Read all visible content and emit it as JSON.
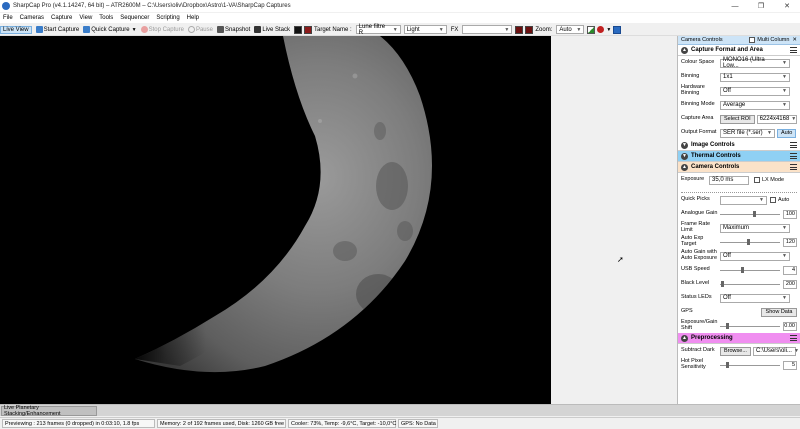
{
  "window": {
    "title": "SharpCap Pro (v4.1.14247, 64 bit) – ATR2600M – C:\\Users\\oliv\\Dropbox\\Astro\\1-VA\\SharpCap Captures",
    "minimize": "—",
    "maximize": "❐",
    "close": "✕"
  },
  "menu": [
    "File",
    "Cameras",
    "Capture",
    "View",
    "Tools",
    "Sequencer",
    "Scripting",
    "Help"
  ],
  "toolbar": {
    "live_view": "Live View",
    "start_capture": "Start Capture",
    "quick_capture": "Quick Capture",
    "stop_capture": "Stop Capture",
    "pause": "Pause",
    "snapshot": "Snapshot",
    "live_stack": "Live Stack",
    "target_name_label": "Target Name :",
    "target_name_value": "Lune filtre R",
    "target_type_value": "Light",
    "fx_label": "FX",
    "zoom_label": "Zoom:",
    "zoom_value": "Auto"
  },
  "panel": {
    "title": "Camera Controls",
    "multi_column": "Multi Column",
    "sections": {
      "capture_format": "Capture Format and Area",
      "image_controls": "Image Controls",
      "thermal_controls": "Thermal Controls",
      "camera_controls": "Camera Controls",
      "preprocessing": "Preprocessing"
    },
    "colour_space": {
      "label": "Colour Space",
      "value": "MONO16 (Ultra Low..."
    },
    "binning": {
      "label": "Binning",
      "value": "1x1"
    },
    "hardware_binning": {
      "label": "Hardware Binning",
      "value": "Off"
    },
    "binning_mode": {
      "label": "Binning Mode",
      "value": "Average"
    },
    "capture_area": {
      "label": "Capture Area",
      "button": "Select ROI",
      "value": "6224x4168"
    },
    "output_format": {
      "label": "Output Format",
      "value": "SER file (*.ser)",
      "auto": "Auto"
    },
    "exposure": {
      "label": "Exposure",
      "value": "35,0 ms",
      "lx_mode": "LX Mode"
    },
    "quick_picks": {
      "label": "Quick Picks",
      "auto": "Auto"
    },
    "analogue_gain": {
      "label": "Analogue Gain",
      "value": "100"
    },
    "frame_rate_limit": {
      "label": "Frame Rate Limit",
      "value": "Maximum"
    },
    "auto_exp_target": {
      "label": "Auto Exp Target",
      "value": "120"
    },
    "auto_gain_exposure": {
      "label": "Auto Gain with Auto Exposure",
      "value": "Off"
    },
    "usb_speed": {
      "label": "USB Speed",
      "value": "4"
    },
    "black_level": {
      "label": "Black Level",
      "value": "200"
    },
    "status_leds": {
      "label": "Status LEDs",
      "value": "Off"
    },
    "gps": {
      "label": "GPS",
      "button": "Show Data"
    },
    "exp_gain_shift": {
      "label": "Exposure/Gain Shift",
      "value": "0.00"
    },
    "subtract_dark": {
      "label": "Subtract Dark",
      "button": "Browse...",
      "value": "C:\\Users\\oli..."
    },
    "hot_pixel": {
      "label": "Hot Pixel Sensitivity",
      "value": "5"
    }
  },
  "bottom_tab": "Live Planetary Stacking/Enhancement",
  "status": {
    "preview": "Previewing : 213 frames (0 dropped) in 0:03:10, 1.8 fps",
    "memory": "Memory: 2 of 192 frames used, Disk: 1260 GB free",
    "cooler": "Cooler: 73%, Temp: -9,6°C, Target: -10,0°C",
    "gps": "GPS: No Data"
  }
}
